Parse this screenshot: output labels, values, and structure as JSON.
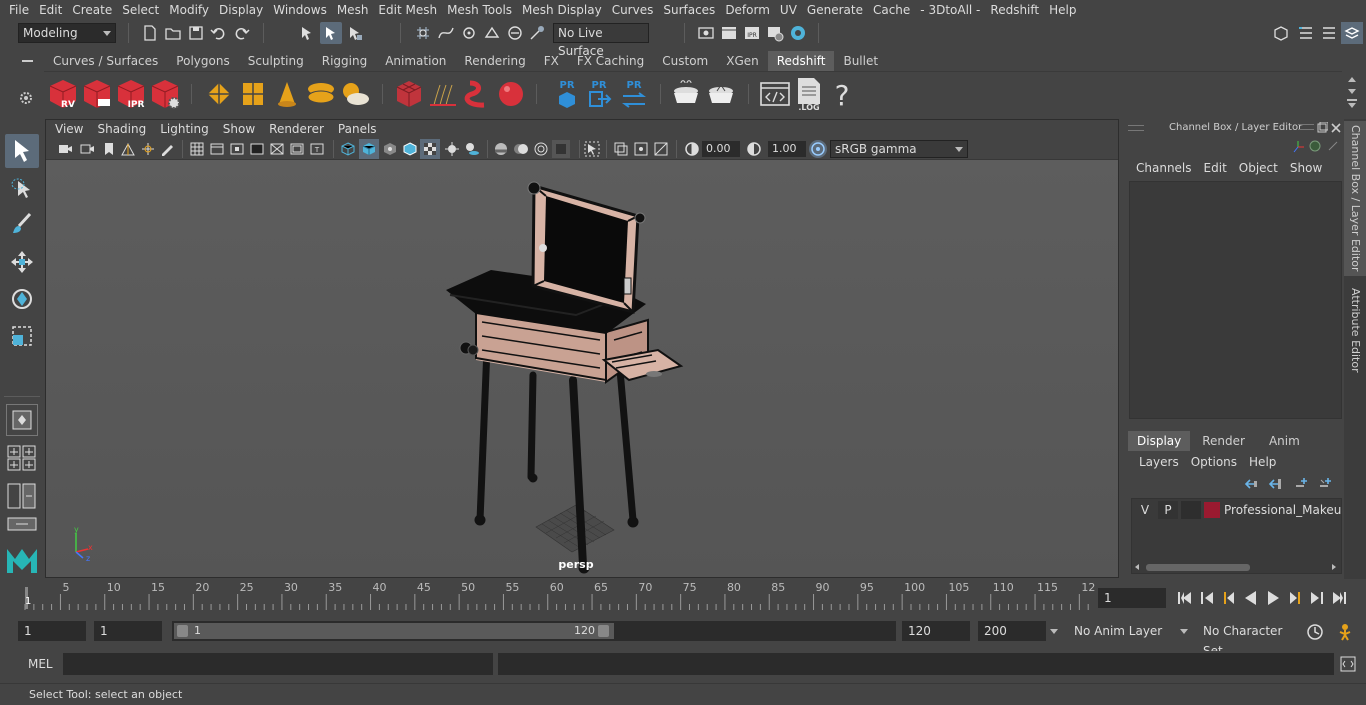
{
  "menubar": {
    "items": [
      "File",
      "Edit",
      "Create",
      "Select",
      "Modify",
      "Display",
      "Windows",
      "Mesh",
      "Edit Mesh",
      "Mesh Tools",
      "Mesh Display",
      "Curves",
      "Surfaces",
      "Deform",
      "UV",
      "Generate",
      "Cache",
      "- 3DtoAll -",
      "Redshift",
      "Help"
    ]
  },
  "statusline": {
    "mode": "Modeling",
    "live_surface": "No Live Surface"
  },
  "shelf": {
    "tabs": [
      "Curves / Surfaces",
      "Polygons",
      "Sculpting",
      "Rigging",
      "Animation",
      "Rendering",
      "FX",
      "FX Caching",
      "Custom",
      "XGen",
      "Redshift",
      "Bullet"
    ],
    "active_tab": "Redshift",
    "icon_labels": {
      "rv": "RV",
      "ipr": "IPR",
      "pr": "PR",
      "log": ".LOG",
      "help": "?"
    }
  },
  "viewport": {
    "menus": [
      "View",
      "Shading",
      "Lighting",
      "Show",
      "Renderer",
      "Panels"
    ],
    "exposure": "0.00",
    "gamma": "1.00",
    "color_space": "sRGB gamma",
    "camera_label": "persp"
  },
  "channel_box": {
    "title": "Channel Box / Layer Editor",
    "menus": [
      "Channels",
      "Edit",
      "Object",
      "Show"
    ]
  },
  "layer_editor": {
    "tabs": [
      "Display",
      "Render",
      "Anim"
    ],
    "active_tab": "Display",
    "menus": [
      "Layers",
      "Options",
      "Help"
    ],
    "layer": {
      "v": "V",
      "p": "P",
      "name": "Professional_Makeup_",
      "color": "#9b1a30"
    }
  },
  "side_tabs": [
    "Channel Box / Layer Editor",
    "Attribute Editor"
  ],
  "timeline": {
    "ticks": [
      "5",
      "10",
      "15",
      "20",
      "25",
      "30",
      "35",
      "40",
      "45",
      "50",
      "55",
      "60",
      "65",
      "70",
      "75",
      "80",
      "85",
      "90",
      "95",
      "100",
      "105",
      "110",
      "115",
      "12"
    ],
    "current_frame_label": "1",
    "current_frame": "1"
  },
  "range": {
    "start": "1",
    "playback_start": "1",
    "slider_start": "1",
    "slider_end": "120",
    "playback_end": "120",
    "end": "200",
    "anim_layer": "No Anim Layer",
    "character_set": "No Character Set"
  },
  "cmdline": {
    "label": "MEL"
  },
  "helpline": {
    "text": "Select Tool: select an object"
  },
  "colors": {
    "accent": "#5c6b7a",
    "redshift_red": "#d8313b",
    "gold": "#e6a21a",
    "pr_blue": "#2f8fd8"
  }
}
